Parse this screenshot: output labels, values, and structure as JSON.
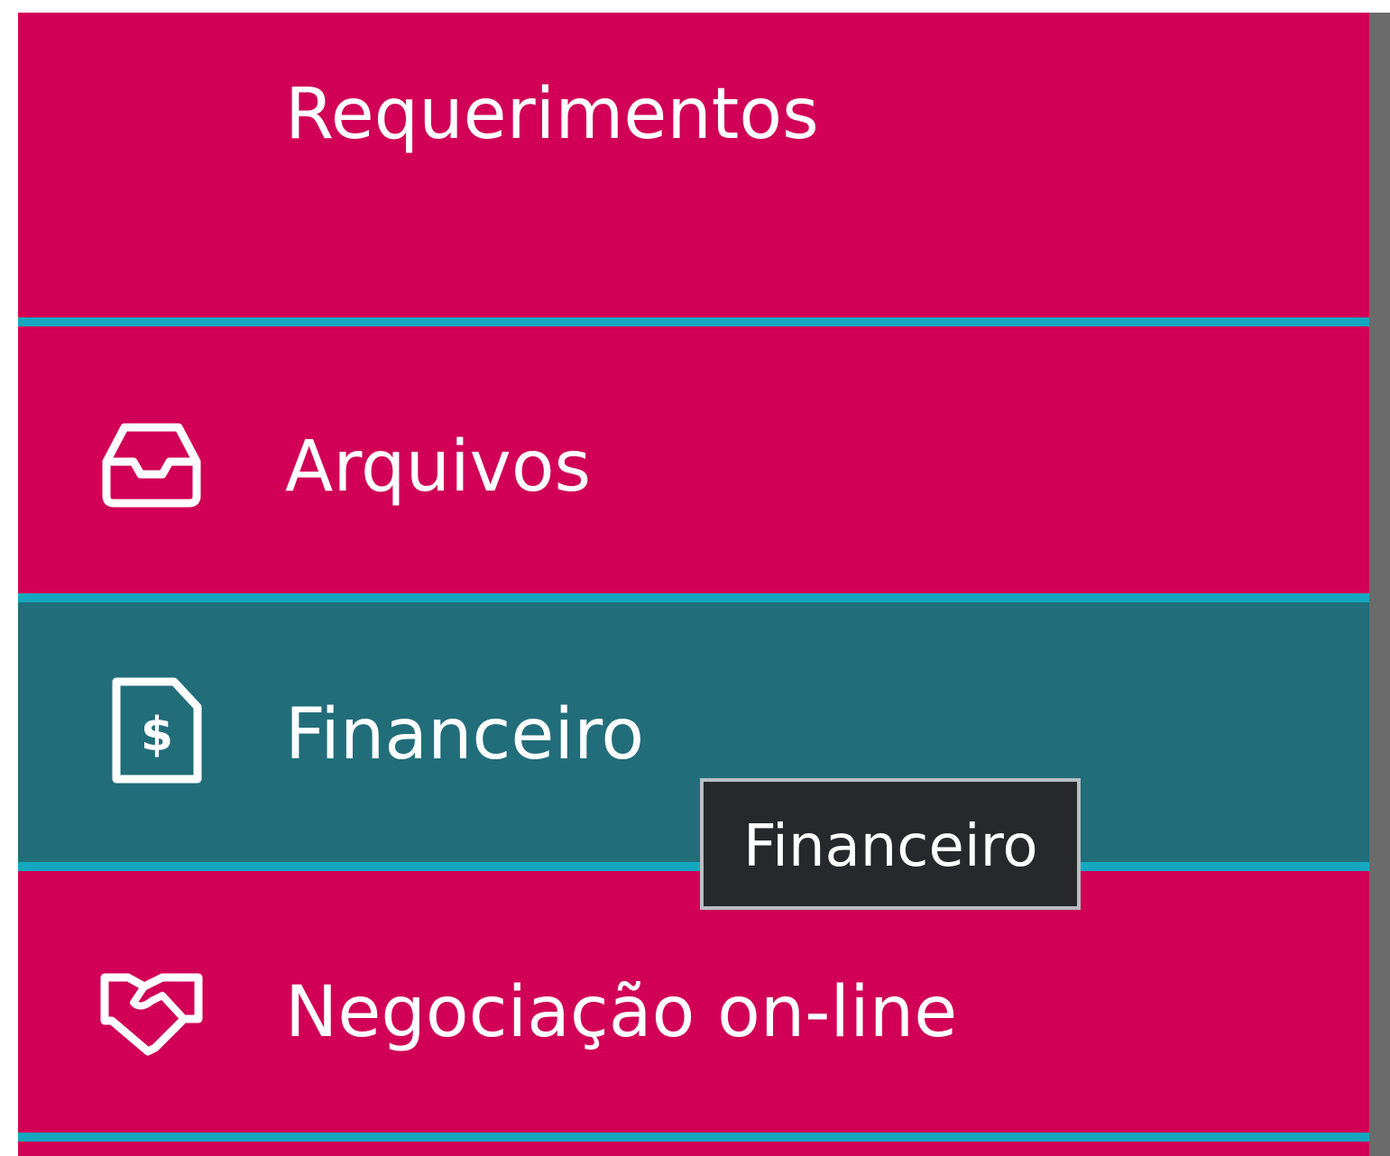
{
  "sidebar": {
    "items": [
      {
        "label": "Requerimentos",
        "icon": "",
        "active": false
      },
      {
        "label": "Arquivos",
        "icon": "inbox-icon",
        "active": false
      },
      {
        "label": "Financeiro",
        "icon": "dollar-document-icon",
        "active": true
      },
      {
        "label": "Negociação on-line",
        "icon": "handshake-icon",
        "active": false
      }
    ]
  },
  "tooltip": {
    "text": "Financeiro"
  },
  "colors": {
    "menu_background": "#d10056",
    "active_background": "#226d7a",
    "divider": "#14a7bf",
    "tooltip_background": "#26282c",
    "tooltip_border": "#b9bec3",
    "text": "#ffffff"
  }
}
